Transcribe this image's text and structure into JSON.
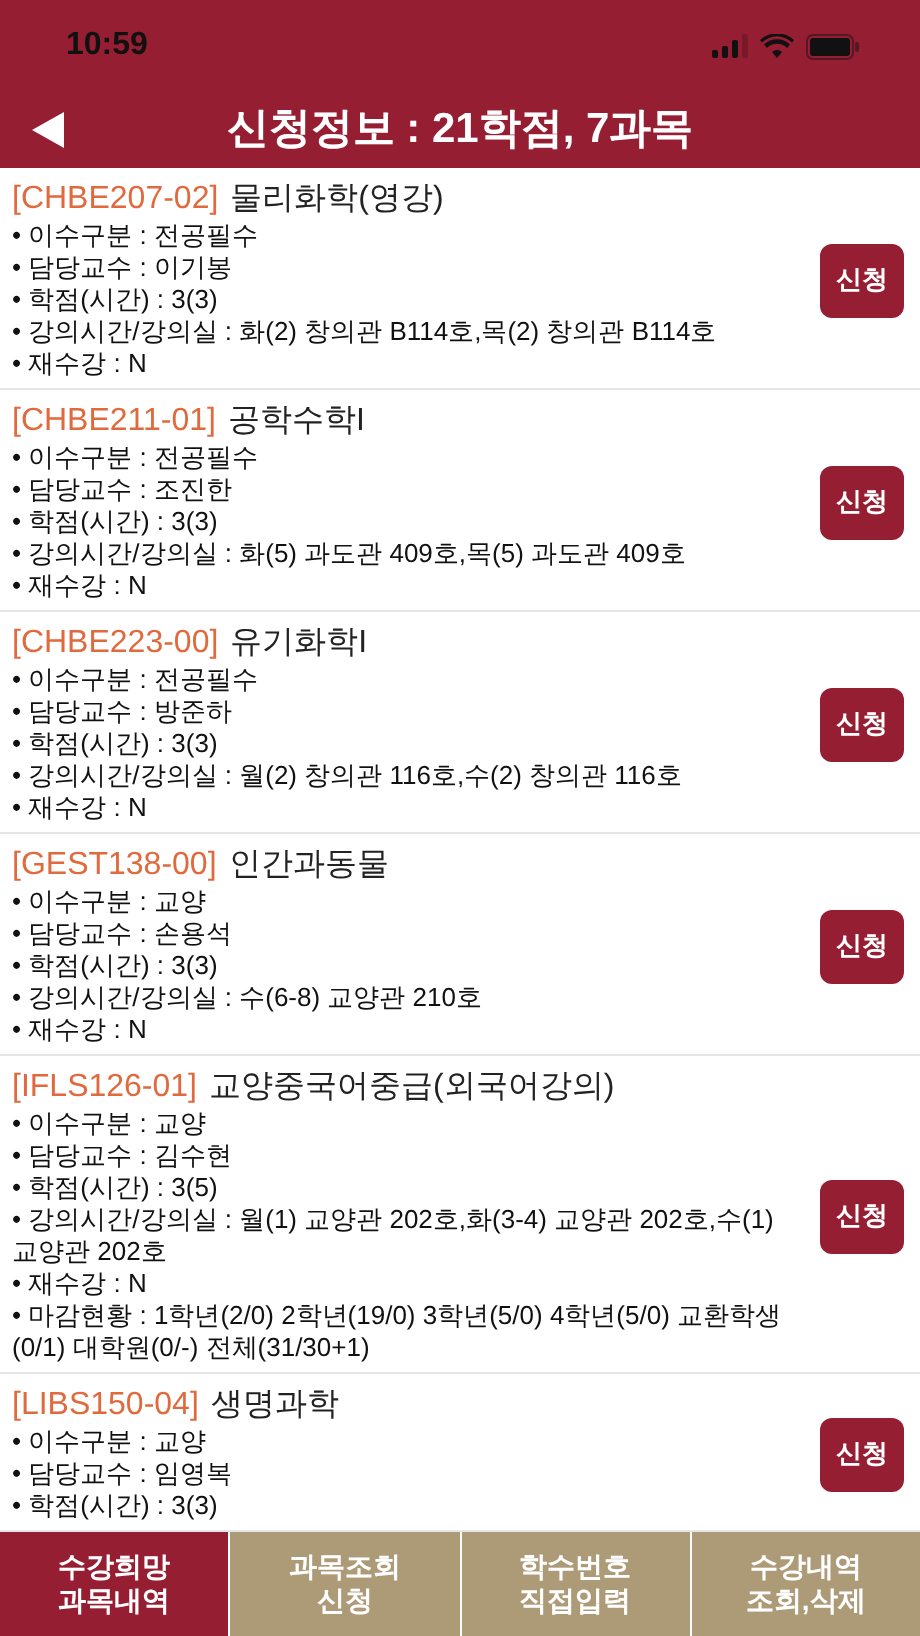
{
  "status_bar": {
    "time": "10:59"
  },
  "header": {
    "title": "신청정보 : 21학점,  7과목"
  },
  "courses": [
    {
      "code": "[CHBE207-02]",
      "name": "물리화학(영강)",
      "button": "신청",
      "details": [
        "• 이수구분 : 전공필수",
        "• 담당교수 : 이기봉",
        "• 학점(시간) : 3(3)",
        "• 강의시간/강의실 : 화(2) 창의관 B114호,목(2) 창의관 B114호",
        "• 재수강 : N"
      ]
    },
    {
      "code": "[CHBE211-01]",
      "name": "공학수학I",
      "button": "신청",
      "details": [
        "• 이수구분 : 전공필수",
        "• 담당교수 : 조진한",
        "• 학점(시간) : 3(3)",
        "• 강의시간/강의실 : 화(5) 과도관 409호,목(5) 과도관 409호",
        "• 재수강 : N"
      ]
    },
    {
      "code": "[CHBE223-00]",
      "name": "유기화학I",
      "button": "신청",
      "details": [
        "• 이수구분 : 전공필수",
        "• 담당교수 : 방준하",
        "• 학점(시간) : 3(3)",
        "• 강의시간/강의실 : 월(2) 창의관 116호,수(2) 창의관 116호",
        "• 재수강 : N"
      ]
    },
    {
      "code": "[GEST138-00]",
      "name": "인간과동물",
      "button": "신청",
      "details": [
        "• 이수구분 : 교양",
        "• 담당교수 : 손용석",
        "• 학점(시간) : 3(3)",
        "• 강의시간/강의실 : 수(6-8) 교양관 210호",
        "• 재수강 : N"
      ]
    },
    {
      "code": "[IFLS126-01]",
      "name": "교양중국어중급(외국어강의)",
      "button": "신청",
      "details": [
        "• 이수구분 : 교양",
        "• 담당교수 : 김수현",
        "• 학점(시간) : 3(5)",
        "• 강의시간/강의실 : 월(1) 교양관 202호,화(3-4) 교양관 202호,수(1) 교양관 202호",
        "• 재수강 : N",
        "• 마감현황 : 1학년(2/0)  2학년(19/0)  3학년(5/0)  4학년(5/0)  교환학생(0/1)  대학원(0/-)  전체(31/30+1)"
      ]
    },
    {
      "code": "[LIBS150-04]",
      "name": "생명과학",
      "button": "신청",
      "details": [
        "• 이수구분 : 교양",
        "• 담당교수 : 임영복",
        "• 학점(시간) : 3(3)"
      ]
    }
  ],
  "tabs": [
    {
      "label": "수강희망\n과목내역",
      "selected": true
    },
    {
      "label": "과목조회\n신청",
      "selected": false
    },
    {
      "label": "학수번호\n직접입력",
      "selected": false
    },
    {
      "label": "수강내역\n조회,삭제",
      "selected": false
    }
  ]
}
